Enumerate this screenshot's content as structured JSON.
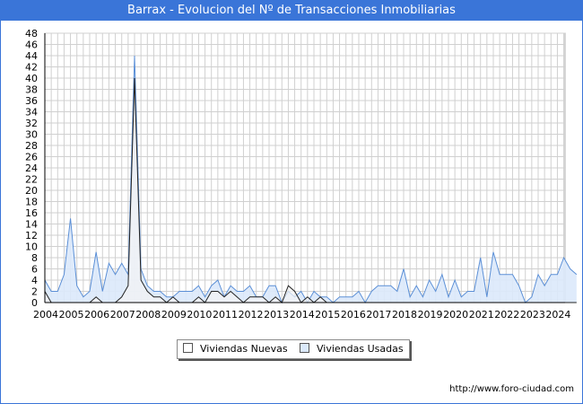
{
  "title": "Barrax - Evolucion del Nº de Transacciones Inmobiliarias",
  "legend": {
    "nuevas": "Viviendas Nuevas",
    "usadas": "Viviendas Usadas"
  },
  "source_url": "http://www.foro-ciudad.com",
  "colors": {
    "title_bar": "#3a75d8",
    "usadas_fill": "#dbe9fb",
    "usadas_line": "#5b8fd6",
    "nuevas_line": "#222222",
    "grid": "#d0d0d0"
  },
  "chart_data": {
    "type": "area",
    "x_start_year": 2004,
    "points_per_year": 4,
    "xticks": [
      "2004",
      "2005",
      "2006",
      "2007",
      "2008",
      "2009",
      "2010",
      "2011",
      "2012",
      "2013",
      "2014",
      "2015",
      "2016",
      "2017",
      "2018",
      "2019",
      "2020",
      "2021",
      "2022",
      "2023",
      "2024"
    ],
    "ylim": [
      0,
      48
    ],
    "yticks": [
      0,
      2,
      4,
      6,
      8,
      10,
      12,
      14,
      16,
      18,
      20,
      22,
      24,
      26,
      28,
      30,
      32,
      34,
      36,
      38,
      40,
      42,
      44,
      46,
      48
    ],
    "grid": true,
    "legend_position": "bottom",
    "series": [
      {
        "name": "Viviendas Usadas",
        "values": [
          4,
          2,
          2,
          5,
          15,
          3,
          1,
          2,
          9,
          2,
          7,
          5,
          7,
          5,
          44,
          6,
          3,
          2,
          2,
          1,
          1,
          2,
          2,
          2,
          3,
          1,
          3,
          4,
          1,
          3,
          2,
          2,
          3,
          1,
          1,
          3,
          3,
          0,
          2,
          1,
          2,
          0,
          2,
          1,
          1,
          0,
          1,
          1,
          1,
          2,
          0,
          2,
          3,
          3,
          3,
          2,
          6,
          1,
          3,
          1,
          4,
          2,
          5,
          1,
          4,
          1,
          2,
          2,
          8,
          1,
          9,
          5,
          5,
          5,
          3,
          0,
          1,
          5,
          3,
          5,
          5,
          8,
          6,
          5
        ]
      },
      {
        "name": "Viviendas Nuevas",
        "values": [
          2,
          0,
          0,
          0,
          0,
          0,
          0,
          0,
          1,
          0,
          0,
          0,
          1,
          3,
          40,
          4,
          2,
          1,
          1,
          0,
          1,
          0,
          0,
          0,
          1,
          0,
          2,
          2,
          1,
          2,
          1,
          0,
          1,
          1,
          1,
          0,
          1,
          0,
          3,
          2,
          0,
          1,
          0,
          1,
          0,
          0,
          0,
          0,
          0,
          0,
          0,
          0,
          0,
          0,
          0,
          0,
          0,
          0,
          0,
          0,
          0,
          0,
          0,
          0,
          0,
          0,
          0,
          0,
          0,
          0,
          0,
          0,
          0,
          0,
          0,
          0,
          0,
          0,
          0,
          0,
          0,
          0,
          0,
          0
        ]
      }
    ]
  }
}
